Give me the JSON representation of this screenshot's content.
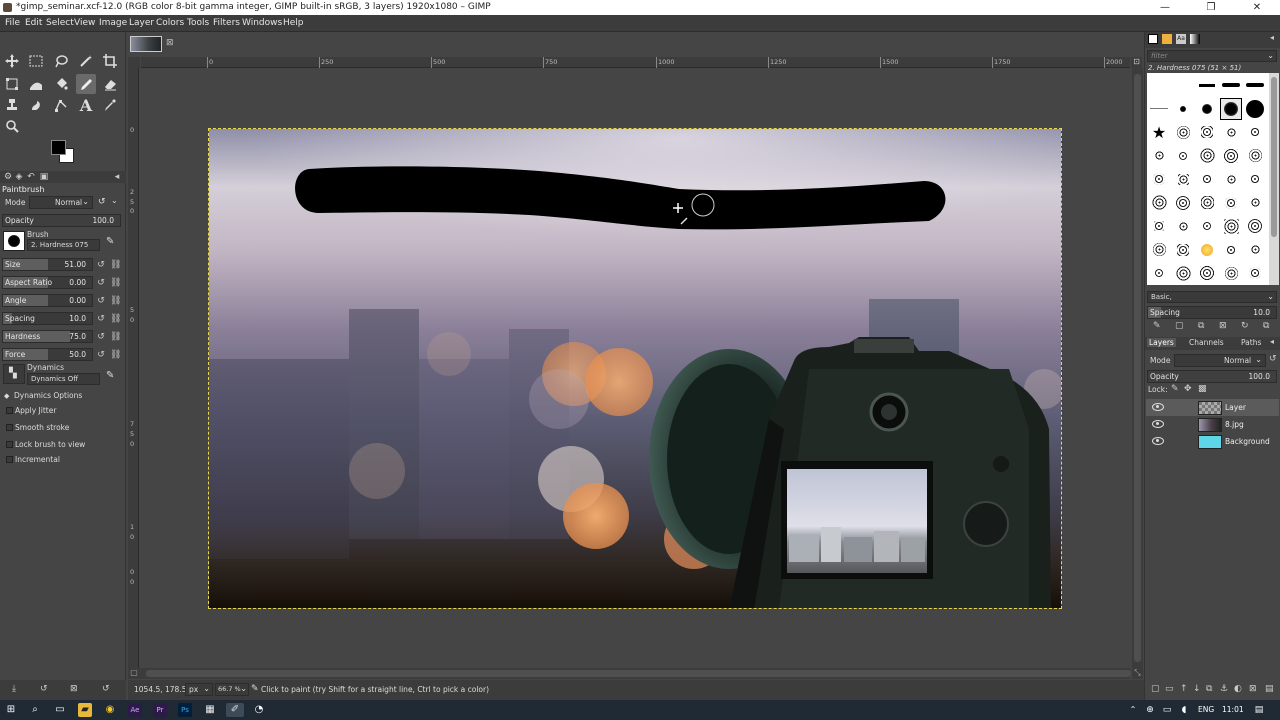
{
  "window": {
    "title": "*gimp_seminar.xcf-12.0 (RGB color 8-bit gamma integer, GIMP built-in sRGB, 3 layers) 1920x1080 – GIMP",
    "minimize": "—",
    "maximize": "❐",
    "close": "✕"
  },
  "menu": [
    "File",
    "Edit",
    "Select",
    "View",
    "Image",
    "Layer",
    "Colors",
    "Tools",
    "Filters",
    "Windows",
    "Help"
  ],
  "tool_options": {
    "title": "Paintbrush",
    "mode_label": "Mode",
    "mode_value": "Normal",
    "opacity_label": "Opacity",
    "opacity_value": "100.0",
    "brush_label": "Brush",
    "brush_name": "2. Hardness 075",
    "sliders": [
      {
        "label": "Size",
        "value": "51.00",
        "fraction": 0.51
      },
      {
        "label": "Aspect Ratio",
        "value": "0.00",
        "fraction": 0.5
      },
      {
        "label": "Angle",
        "value": "0.00",
        "fraction": 0.5
      },
      {
        "label": "Spacing",
        "value": "10.0",
        "fraction": 0.1
      },
      {
        "label": "Hardness",
        "value": "75.0",
        "fraction": 0.75
      },
      {
        "label": "Force",
        "value": "50.0",
        "fraction": 0.5
      }
    ],
    "dynamics_label": "Dynamics",
    "dynamics_value": "Dynamics Off",
    "dynamics_options": "Dynamics Options",
    "checkboxes": [
      "Apply Jitter",
      "Smooth stroke",
      "Lock brush to view",
      "Incremental"
    ]
  },
  "rulers": {
    "top": [
      "0",
      "250",
      "500",
      "750",
      "1000",
      "1250",
      "1500",
      "1750",
      "2000"
    ],
    "left": [
      "0",
      "2",
      "5",
      "0",
      "5",
      "0",
      "7",
      "5",
      "0",
      "1",
      "0",
      "0",
      "0"
    ]
  },
  "status": {
    "coords": "1054.5, 178.5",
    "unit": "px",
    "zoom": "66.7 %",
    "message": "Click to paint (try Shift for a straight line, Ctrl to pick a color)"
  },
  "brushes": {
    "filter_placeholder": "filter",
    "current": "2. Hardness 075 (51 × 51)",
    "tag": "Basic,",
    "spacing_label": "Spacing",
    "spacing_value": "10.0"
  },
  "layers_panel": {
    "tabs": [
      "Layers",
      "Channels",
      "Paths"
    ],
    "mode_label": "Mode",
    "mode_value": "Normal",
    "opacity_label": "Opacity",
    "opacity_value": "100.0",
    "lock_label": "Lock:",
    "layers": [
      {
        "name": "Layer",
        "selected": true
      },
      {
        "name": "8.jpg",
        "selected": false
      },
      {
        "name": "Background",
        "selected": false
      }
    ]
  },
  "taskbar": {
    "lang": "ENG",
    "time": "11:01"
  },
  "colors": {
    "fg": "#000000",
    "bg": "#ffffff",
    "selection": "#e8d84a",
    "background_layer": "#5fd6e8"
  }
}
